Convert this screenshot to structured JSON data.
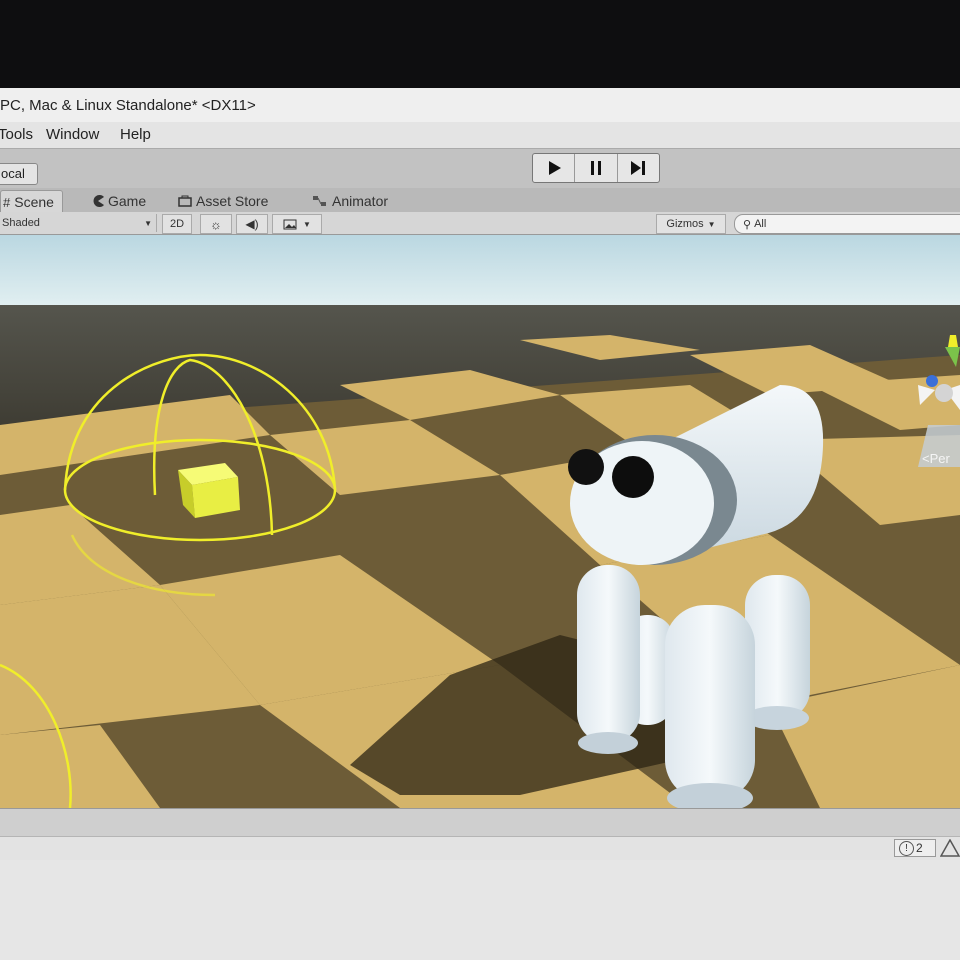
{
  "window": {
    "title": "PC, Mac & Linux Standalone* <DX11>"
  },
  "menu": {
    "items": [
      "Tools",
      "Window",
      "Help"
    ]
  },
  "toolbar": {
    "local_label": "ocal",
    "play_icon": "play-icon",
    "pause_icon": "pause-icon",
    "step_icon": "step-icon"
  },
  "tabs": [
    {
      "label": "Scene",
      "icon": "scene-hash-icon",
      "active": true
    },
    {
      "label": "Game",
      "icon": "game-pacman-icon"
    },
    {
      "label": "Asset Store",
      "icon": "asset-store-icon"
    },
    {
      "label": "Animator",
      "icon": "animator-icon"
    }
  ],
  "scene_toolbar": {
    "draw_mode": "Shaded",
    "mode_2d": "2D",
    "gizmos": "Gizmos",
    "search_placeholder": "All"
  },
  "scene_gizmo": {
    "projection_label": "<Per"
  },
  "status": {
    "warning_count": "2"
  },
  "colors": {
    "checker_light": "#d4b46a",
    "checker_dark": "#6b5a35",
    "sky": "#b6d6e0",
    "cube": "#e8ee4a",
    "wire": "#f0ee2a",
    "body": "#e6eef2"
  }
}
